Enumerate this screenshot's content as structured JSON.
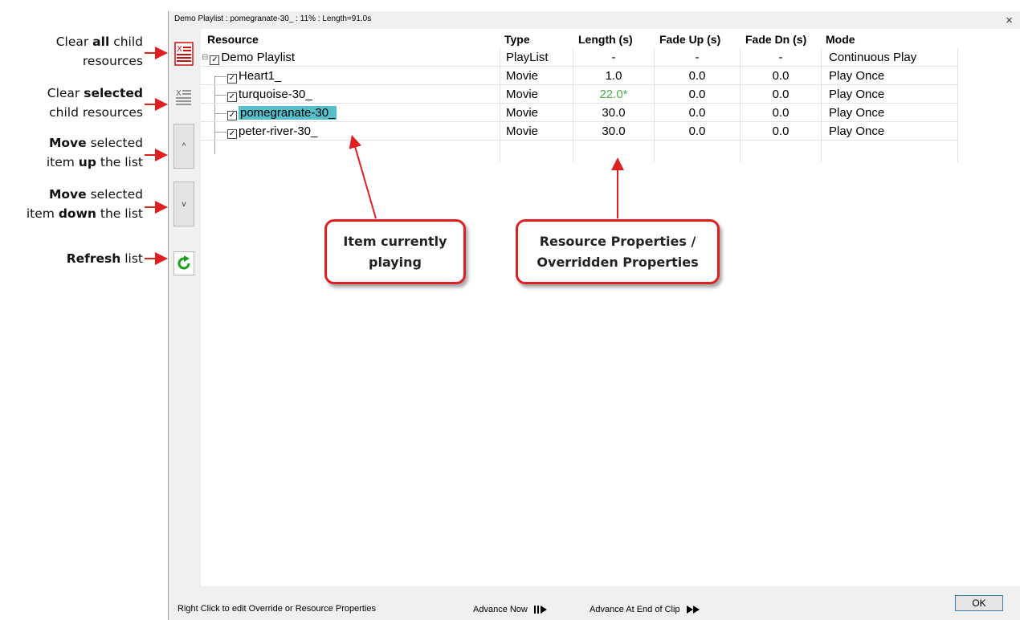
{
  "window": {
    "title": "Demo Playlist : pomegranate-30_ : 11% : Length=91.0s",
    "close_label": "×"
  },
  "annotations": {
    "clear_all": {
      "pre": "Clear ",
      "bold": "all",
      "post": " child",
      "line2": "resources"
    },
    "clear_selected": {
      "pre": "Clear ",
      "bold": "selected",
      "post": "",
      "line2": "child resources"
    },
    "move_up": {
      "bold1": "Move",
      "post1": " selected",
      "pre2": "item ",
      "bold2": "up",
      "post2": " the list"
    },
    "move_down": {
      "bold1": "Move",
      "post1": " selected",
      "pre2": "item ",
      "bold2": "down",
      "post2": " the list"
    },
    "refresh": {
      "bold": "Refresh",
      "post": " list"
    }
  },
  "toolbar": {
    "up_label": "^",
    "down_label": "v"
  },
  "columns": [
    "Resource",
    "Type",
    "Length (s)",
    "Fade Up (s)",
    "Fade Dn (s)",
    "Mode"
  ],
  "rows": [
    {
      "name": "Demo Playlist",
      "type": "PlayList",
      "length": "-",
      "fade_up": "-",
      "fade_dn": "-",
      "mode": "Continuous Play"
    },
    {
      "name": "Heart1_",
      "type": "Movie",
      "length": "1.0",
      "fade_up": "0.0",
      "fade_dn": "0.0",
      "mode": "Play Once"
    },
    {
      "name": "turquoise-30_",
      "type": "Movie",
      "length": "22.0*",
      "fade_up": "0.0",
      "fade_dn": "0.0",
      "mode": "Play Once"
    },
    {
      "name": "pomegranate-30_",
      "type": "Movie",
      "length": "30.0",
      "fade_up": "0.0",
      "fade_dn": "0.0",
      "mode": "Play Once"
    },
    {
      "name": "peter-river-30_",
      "type": "Movie",
      "length": "30.0",
      "fade_up": "0.0",
      "fade_dn": "0.0",
      "mode": "Play Once"
    }
  ],
  "callouts": {
    "playing": {
      "line1": "Item currently",
      "line2": "playing"
    },
    "properties": {
      "line1": "Resource Properties /",
      "line2": "Overridden Properties"
    }
  },
  "footer": {
    "hint": "Right Click to edit Override or Resource Properties",
    "advance_now": "Advance Now",
    "advance_end": "Advance At End of Clip",
    "ok": "OK"
  },
  "colors": {
    "annotation_red": "#e02020",
    "selection": "#55c0cc",
    "overridden_value": "#4cae4c",
    "refresh_green": "#1aa01a"
  },
  "icons": [
    "clear-all-icon",
    "clear-selected-icon",
    "refresh-icon",
    "advance-now-icon",
    "advance-end-icon"
  ]
}
